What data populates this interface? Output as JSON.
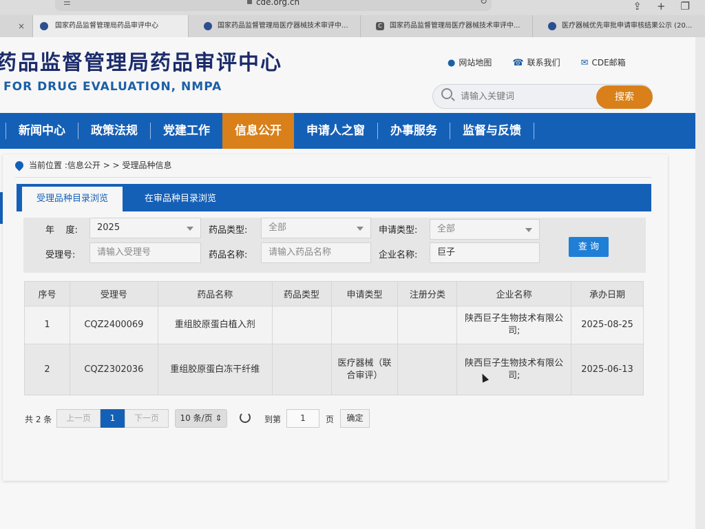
{
  "browser": {
    "url": "cde.org.cn",
    "tabs": [
      {
        "label": "国家药品监督管理局药品审评中心",
        "close": "×"
      },
      {
        "label": "国家药品监督管理局医疗器械技术审评中..."
      },
      {
        "label": "国家药品监督管理局医疗器械技术审评中...",
        "fav": "C"
      },
      {
        "label": "医疗器械优先审批申请审核结果公示 (20..."
      }
    ]
  },
  "header": {
    "title": "药品监督管理局药品审评中心",
    "subtitle": "FOR DRUG EVALUATION, NMPA",
    "links": {
      "sitemap": "网站地图",
      "contact": "联系我们",
      "mail": "CDE邮箱"
    },
    "search": {
      "placeholder": "请输入关键词",
      "button": "搜索"
    }
  },
  "nav": [
    "新闻中心",
    "政策法规",
    "党建工作",
    "信息公开",
    "申请人之窗",
    "办事服务",
    "监督与反馈"
  ],
  "breadcrumb": {
    "prefix": "当前位置 : ",
    "path1": "信息公开",
    "sep": " > > ",
    "path2": "受理品种信息"
  },
  "content_tabs": [
    "受理品种目录浏览",
    "在审品种目录浏览"
  ],
  "filters": {
    "year_label": "年    度:",
    "year_value": "2025",
    "drug_type_label": "药品类型:",
    "drug_type_value": "全部",
    "apply_type_label": "申请类型:",
    "apply_type_value": "全部",
    "accept_no_label": "受理号:",
    "accept_no_placeholder": "请输入受理号",
    "drug_name_label": "药品名称:",
    "drug_name_placeholder": "请输入药品名称",
    "company_label": "企业名称:",
    "company_value": "巨子",
    "query_button": "查 询"
  },
  "table": {
    "headers": [
      "序号",
      "受理号",
      "药品名称",
      "药品类型",
      "申请类型",
      "注册分类",
      "企业名称",
      "承办日期"
    ],
    "rows": [
      {
        "no": "1",
        "accept_no": "CQZ2400069",
        "name": "重组胶原蛋白植入剂",
        "drug_type": "",
        "apply_type": "",
        "reg_class": "",
        "company": "陕西巨子生物技术有限公司;",
        "date": "2025-08-25"
      },
      {
        "no": "2",
        "accept_no": "CQZ2302036",
        "name": "重组胶原蛋白冻干纤维",
        "drug_type": "",
        "apply_type": "医疗器械（联合审评）",
        "reg_class": "",
        "company": "陕西巨子生物技术有限公司;",
        "date": "2025-06-13"
      }
    ]
  },
  "pager": {
    "total": "共 2 条",
    "prev": "上一页",
    "current": "1",
    "next": "下一页",
    "page_size": "10 条/页",
    "goto_label": "到第",
    "goto_value": "1",
    "page_unit": "页",
    "confirm": "确定"
  },
  "colors": {
    "brand_blue": "#1560b7",
    "accent_orange": "#d9801a"
  }
}
